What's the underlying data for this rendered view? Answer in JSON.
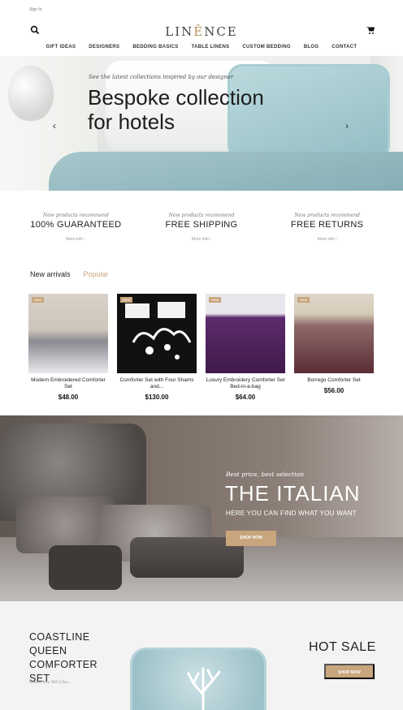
{
  "topbar": {
    "signin_label": "Sign In"
  },
  "header": {
    "logo_prefix": "LIN",
    "logo_accent": "Ê",
    "logo_suffix": "NCE",
    "search_icon": "search-icon",
    "cart_icon": "cart-icon"
  },
  "nav": {
    "items": [
      "GIFT IDEAS",
      "DESIGNERS",
      "BEDDING BASICS",
      "TABLE LINENS",
      "CUSTOM BEDDING",
      "BLOG",
      "CONTACT"
    ]
  },
  "hero": {
    "tagline": "See the latest collections inspired by our designer",
    "headline": "Bespoke collection for hotels",
    "prev_icon": "chevron-left-icon",
    "next_icon": "chevron-right-icon"
  },
  "features": [
    {
      "kicker": "New products recommend",
      "title": "100% GUARANTEED",
      "more": "More info  ›"
    },
    {
      "kicker": "New products recommend",
      "title": "FREE SHIPPING",
      "more": "More info  ›"
    },
    {
      "kicker": "New products recommend",
      "title": "FREE RETURNS",
      "more": "More info  ›"
    }
  ],
  "tabs": {
    "new_arrivals": "New arrivals",
    "popular": "Popular"
  },
  "products": [
    {
      "badge": "NEW",
      "name": "Modern Embroidered Comforter Set",
      "price": "$48.00"
    },
    {
      "badge": "NEW",
      "name": "Comforter Set with Four Shams and...",
      "price": "$130.00"
    },
    {
      "badge": "NEW",
      "name": "Luxury Embroidery Comforter Set Bed-in-a-bag",
      "price": "$64.00"
    },
    {
      "badge": "NEW",
      "name": "Borrego Comforter Set",
      "price": "$56.00"
    }
  ],
  "italian": {
    "kicker": "Best price, best selection",
    "title": "THE ITALIAN",
    "subtitle": "HERE YOU CAN FIND WHAT YOU WANT",
    "button": "SHOP NOW"
  },
  "hotsale": {
    "product_title": "COASTLINE QUEEN COMFORTER SET",
    "kicker": "Guest You Wil Like...",
    "title": "HOT SALE",
    "button": "SHOP NOW"
  },
  "colors": {
    "accent": "#c8a57c",
    "text": "#222222",
    "hero_blue": "#a6c7cc"
  }
}
